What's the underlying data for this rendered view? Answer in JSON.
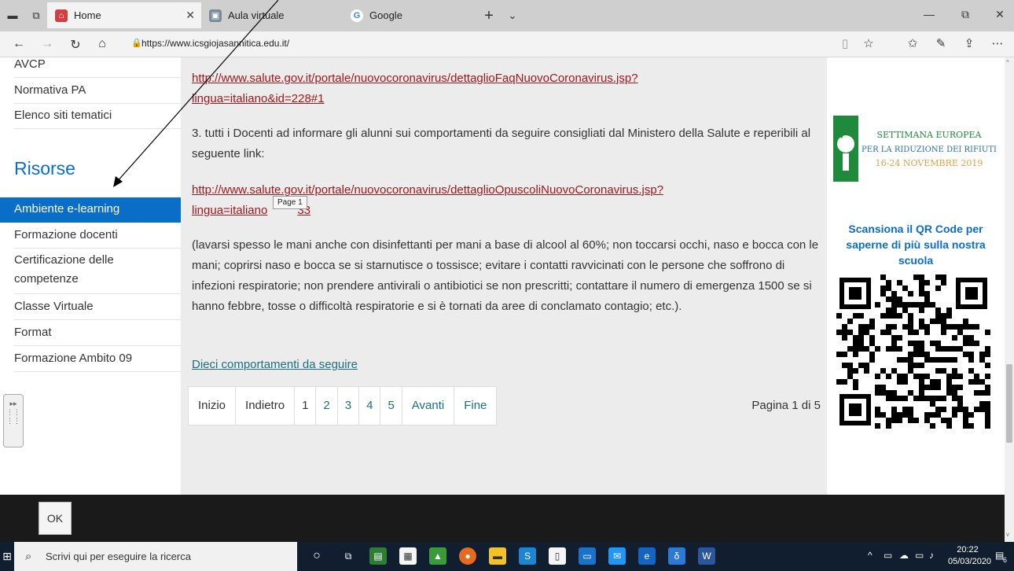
{
  "browser": {
    "tabs": [
      {
        "label": "Home",
        "active": true
      },
      {
        "label": "Aula virtuale",
        "active": false
      },
      {
        "label": "Google",
        "active": false
      }
    ],
    "new_tab_label": "+",
    "url": "https://www.icsgiojasannitica.edu.it/"
  },
  "sidebar": {
    "top_items": [
      "AVCP",
      "Normativa PA",
      "Elenco siti tematici"
    ],
    "section_title": "Risorse",
    "items": [
      {
        "label": "Ambiente e-learning",
        "active": true
      },
      {
        "label": "Formazione docenti"
      },
      {
        "label": "Certificazione delle competenze"
      },
      {
        "label": "Classe Virtuale"
      },
      {
        "label": "Format"
      },
      {
        "label": "Formazione Ambito 09"
      }
    ]
  },
  "content": {
    "link1_line1": "http://www.salute.gov.it/portale/nuovocoronavirus/dettaglioFaqNuovoCoronavirus.jsp?",
    "link1_line2": "lingua=italiano&id=228#1",
    "para3": "3. tutti i Docenti ad informare gli alunni sui comportamenti da seguire consigliati dal Ministero della Salute e reperibili al seguente link:",
    "link2_line1": "http://www.salute.gov.it/portale/nuovocoronavirus/dettaglioOpuscoliNuovoCoronavirus.jsp?",
    "link2_line2a": "lingua=italiano",
    "link2_line2b": "33",
    "tooltip": "Page 1",
    "para4": "(lavarsi spesso le mani anche con disinfettanti per mani a base di alcool al 60%; non toccarsi occhi, naso e bocca con le mani; coprirsi naso e bocca se si starnutisce o tossisce; evitare i contatti ravvicinati con le persone che soffrono di infezioni respiratorie; non prendere antivirali o antibiotici se non prescritti; contattare il numero di emergenza 1500 se si hanno febbre, tosse o difficoltà respiratorie e si è tornati da aree di conclamato contagio; etc.).",
    "link3": "Dieci comportamenti da seguire",
    "pager": {
      "first": "Inizio",
      "prev": "Indietro",
      "pages": [
        "1",
        "2",
        "3",
        "4",
        "5"
      ],
      "next": "Avanti",
      "last": "Fine",
      "info": "Pagina 1 di 5"
    }
  },
  "right": {
    "banner_lines": [
      "SETTIMANA EUROPEA",
      "PER LA RIDUZIONE DEI RIFIUTI",
      "16-24 NOVEMBRE 2019"
    ],
    "qr_text": "Scansiona il QR Code per saperne di più sulla nostra scuola"
  },
  "footer": {
    "ok_label": "OK"
  },
  "taskbar": {
    "search_placeholder": "Scrivi qui per eseguire la ricerca",
    "time": "20:22",
    "date": "05/03/2020",
    "notification_count": "6"
  },
  "colors": {
    "accent": "#0a6ec9",
    "link_red": "#a0181c",
    "link_teal": "#1b6f80"
  }
}
